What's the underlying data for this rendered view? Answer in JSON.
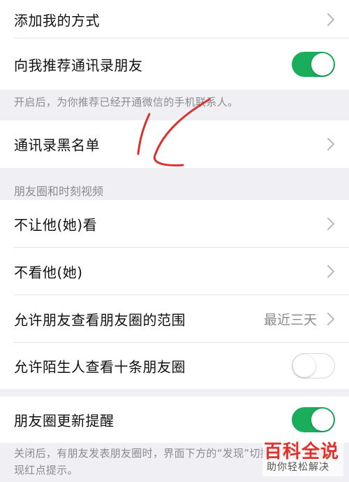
{
  "rows": {
    "add_method": "添加我的方式",
    "recommend_contacts": "向我推荐通讯录朋友",
    "blacklist": "通讯录黑名单",
    "hide_my_moments": "不让他(她)看",
    "hide_their_moments": "不看他(她)",
    "moments_range": "允许朋友查看朋友圈的范围",
    "moments_range_value": "最近三天",
    "stranger_view": "允许陌生人查看十条朋友圈",
    "moments_update": "朋友圈更新提醒"
  },
  "toggles": {
    "recommend_contacts": true,
    "stranger_view": false,
    "moments_update": true
  },
  "notes": {
    "recommend_contacts": "开启后，为你推荐已经开通微信的手机联系人。",
    "moments_update": "关闭后，有朋友发表朋友圈时，界面下方的“发现”切换按钮上不再出现红点提示。"
  },
  "sections": {
    "moments_and_video": "朋友圈和时刻视频"
  },
  "watermark": {
    "title": "百科全说",
    "subtitle": "助你轻松解决"
  },
  "colors": {
    "toggle_on": "#1aad5c",
    "background": "#efeff4",
    "annotation": "#d9322b",
    "watermark": "#e0312b"
  },
  "icons": {
    "chevron": "chevron-right-icon"
  }
}
